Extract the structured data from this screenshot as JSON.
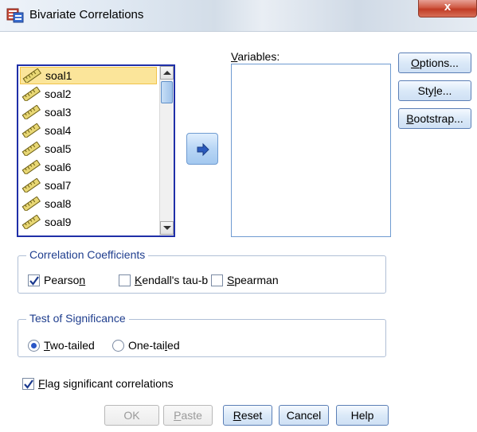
{
  "window": {
    "title": "Bivariate Correlations",
    "close_label": "x"
  },
  "source_list": {
    "items": [
      {
        "label": "soal1",
        "selected": true
      },
      {
        "label": "soal2"
      },
      {
        "label": "soal3"
      },
      {
        "label": "soal4"
      },
      {
        "label": "soal5"
      },
      {
        "label": "soal6"
      },
      {
        "label": "soal7"
      },
      {
        "label": "soal8"
      },
      {
        "label": "soal9"
      }
    ]
  },
  "variables": {
    "label_prefix": "",
    "label_accel": "V",
    "label_rest": "ariables:"
  },
  "side_buttons": {
    "options": {
      "pre": "",
      "accel": "O",
      "post": "ptions..."
    },
    "style": {
      "pre": "Sty",
      "accel": "l",
      "post": "e..."
    },
    "bootstrap": {
      "pre": "",
      "accel": "B",
      "post": "ootstrap..."
    }
  },
  "correlation": {
    "legend": "Correlation Coefficients",
    "pearson": {
      "pre": "Pearso",
      "accel": "n",
      "post": "",
      "checked": true
    },
    "kendall": {
      "pre": "",
      "accel": "K",
      "post": "endall's tau-b",
      "checked": false
    },
    "spearman": {
      "pre": "",
      "accel": "S",
      "post": "pearman",
      "checked": false
    }
  },
  "significance": {
    "legend": "Test of Significance",
    "two_tailed": {
      "pre": "",
      "accel": "T",
      "post": "wo-tailed",
      "selected": true
    },
    "one_tailed": {
      "pre": "One-tai",
      "accel": "l",
      "post": "ed",
      "selected": false
    }
  },
  "flag": {
    "pre": "",
    "accel": "F",
    "post": "lag significant correlations",
    "checked": true
  },
  "bottom_buttons": {
    "ok": {
      "pre": "OK",
      "accel": "",
      "post": "",
      "disabled": true
    },
    "paste": {
      "pre": "",
      "accel": "P",
      "post": "aste",
      "disabled": true
    },
    "reset": {
      "pre": "",
      "accel": "R",
      "post": "eset",
      "disabled": false
    },
    "cancel": {
      "pre": "Cancel",
      "accel": "",
      "post": "",
      "disabled": false
    },
    "help": {
      "pre": "Help",
      "accel": "",
      "post": "",
      "disabled": false
    }
  },
  "colors": {
    "accent": "#1f2fa8",
    "legend_text": "#1f3e8e",
    "selection": "#fbe59a",
    "checkmark": "#1b3a8f"
  }
}
